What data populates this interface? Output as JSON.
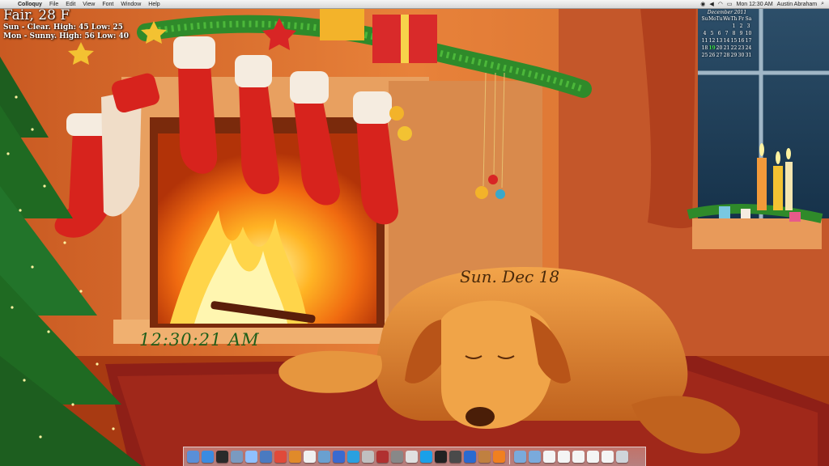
{
  "menubar": {
    "app_name": "Colloquy",
    "menus": [
      "File",
      "Edit",
      "View",
      "Font",
      "Window",
      "Help"
    ],
    "clock": "Mon 12:30 AM",
    "user": "Austin Abraham",
    "apple_glyph": "",
    "search_glyph": "⌕"
  },
  "weather": {
    "condition": "Fair, 28 F",
    "forecast_1": "Sun - Clear. High: 45 Low: 25",
    "forecast_2": "Mon - Sunny. High: 56 Low: 40"
  },
  "calendar": {
    "month_label": "December 2011",
    "weekdays": [
      "Su",
      "Mo",
      "Tu",
      "We",
      "Th",
      "Fr",
      "Sa"
    ],
    "weeks": [
      [
        "",
        "",
        "",
        "",
        "1",
        "2",
        "3"
      ],
      [
        "4",
        "5",
        "6",
        "7",
        "8",
        "9",
        "10"
      ],
      [
        "11",
        "12",
        "13",
        "14",
        "15",
        "16",
        "17"
      ],
      [
        "18",
        "19",
        "20",
        "21",
        "22",
        "23",
        "24"
      ],
      [
        "25",
        "26",
        "27",
        "28",
        "29",
        "30",
        "31"
      ]
    ],
    "today": "19"
  },
  "date_text": "Sun. Dec 18",
  "clock_text": "12:30:21 AM",
  "dock": {
    "apps": [
      "finder",
      "safari",
      "dashboard",
      "mail",
      "ichat",
      "itunes",
      "chrome",
      "firefox",
      "calendar",
      "photos",
      "itunes-2",
      "app-store",
      "preview",
      "photo-booth",
      "system-prefs",
      "textedit",
      "skype",
      "terminal",
      "activity-monitor",
      "xcode",
      "automator",
      "vlc"
    ],
    "docs": [
      "downloads",
      "documents",
      "file-1",
      "file-2",
      "file-3",
      "file-4",
      "file-5",
      "trash"
    ]
  }
}
